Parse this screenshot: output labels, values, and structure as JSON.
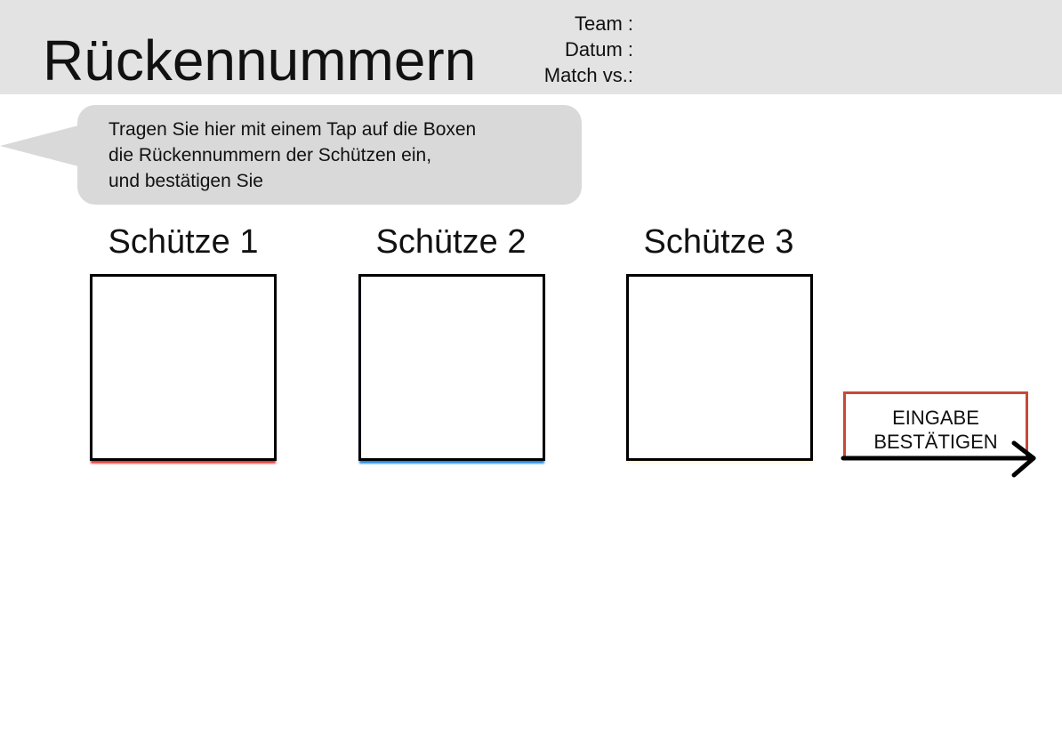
{
  "header": {
    "title": "Rückennummern",
    "meta": {
      "team_label": "Team :",
      "date_label": "Datum :",
      "match_label": "Match vs.:"
    }
  },
  "hint": {
    "lines": [
      "Tragen Sie hier mit einem Tap auf die Boxen",
      "die Rückennummern der Schützen ein,",
      "und bestätigen Sie"
    ]
  },
  "shooters": [
    {
      "label": "Schütze 1",
      "value": "",
      "accent_color": "#e53935"
    },
    {
      "label": "Schütze 2",
      "value": "",
      "accent_color": "#1e88e5"
    },
    {
      "label": "Schütze 3",
      "value": "",
      "accent_color": "#fdf7dc"
    }
  ],
  "confirm": {
    "line1": "EINGABE",
    "line2": "BESTÄTIGEN",
    "border_color": "#c84a35",
    "icon": "arrow-right-icon"
  },
  "colors": {
    "header_bg": "#e3e3e3",
    "hint_bg": "#d9d9d9"
  }
}
